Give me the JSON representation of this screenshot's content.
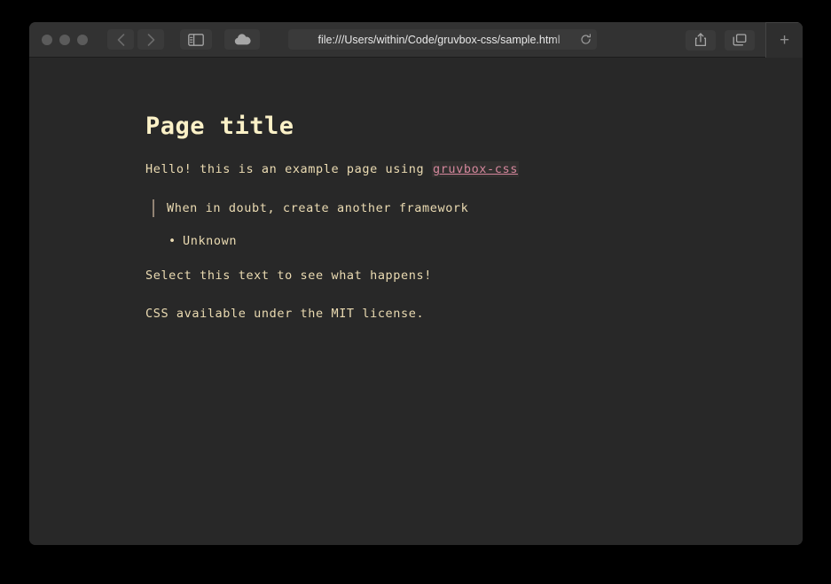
{
  "browser": {
    "traffic_lights": [
      "close",
      "minimize",
      "zoom"
    ],
    "back_label": "‹",
    "forward_label": "›",
    "url": "file:///Users/within/Code/gruvbox-css/sample.html",
    "newtab_label": "+",
    "icons": {
      "sidebar": "sidebar-icon",
      "cloud": "icloud-tabs-icon",
      "reload": "reload-icon",
      "share": "share-icon",
      "tabs": "show-tabs-icon"
    }
  },
  "page": {
    "title": "Page title",
    "intro_before": "Hello! this is an example page using ",
    "intro_link": "gruvbox-css",
    "quote": "When in doubt, create another framework",
    "attribution": [
      "Unknown"
    ],
    "select_text": "Select this text to see what happens!",
    "license_text": "CSS available under the MIT license."
  },
  "colors": {
    "page_bg": "#282828",
    "text": "#ebdbb2",
    "heading": "#fbf1c7",
    "link": "#d3869b",
    "quote_border": "#928374",
    "chrome_bg": "#323232",
    "backdrop": "#000000"
  }
}
